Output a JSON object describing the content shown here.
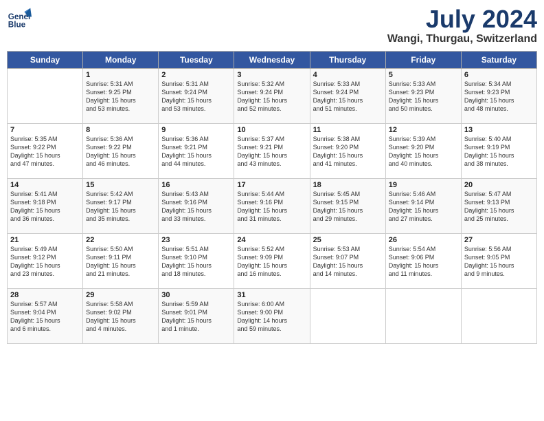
{
  "logo": {
    "line1": "General",
    "line2": "Blue"
  },
  "title": {
    "month_year": "July 2024",
    "location": "Wangi, Thurgau, Switzerland"
  },
  "days_of_week": [
    "Sunday",
    "Monday",
    "Tuesday",
    "Wednesday",
    "Thursday",
    "Friday",
    "Saturday"
  ],
  "weeks": [
    [
      {
        "day": "",
        "info": ""
      },
      {
        "day": "1",
        "info": "Sunrise: 5:31 AM\nSunset: 9:25 PM\nDaylight: 15 hours\nand 53 minutes."
      },
      {
        "day": "2",
        "info": "Sunrise: 5:31 AM\nSunset: 9:24 PM\nDaylight: 15 hours\nand 53 minutes."
      },
      {
        "day": "3",
        "info": "Sunrise: 5:32 AM\nSunset: 9:24 PM\nDaylight: 15 hours\nand 52 minutes."
      },
      {
        "day": "4",
        "info": "Sunrise: 5:33 AM\nSunset: 9:24 PM\nDaylight: 15 hours\nand 51 minutes."
      },
      {
        "day": "5",
        "info": "Sunrise: 5:33 AM\nSunset: 9:23 PM\nDaylight: 15 hours\nand 50 minutes."
      },
      {
        "day": "6",
        "info": "Sunrise: 5:34 AM\nSunset: 9:23 PM\nDaylight: 15 hours\nand 48 minutes."
      }
    ],
    [
      {
        "day": "7",
        "info": "Sunrise: 5:35 AM\nSunset: 9:22 PM\nDaylight: 15 hours\nand 47 minutes."
      },
      {
        "day": "8",
        "info": "Sunrise: 5:36 AM\nSunset: 9:22 PM\nDaylight: 15 hours\nand 46 minutes."
      },
      {
        "day": "9",
        "info": "Sunrise: 5:36 AM\nSunset: 9:21 PM\nDaylight: 15 hours\nand 44 minutes."
      },
      {
        "day": "10",
        "info": "Sunrise: 5:37 AM\nSunset: 9:21 PM\nDaylight: 15 hours\nand 43 minutes."
      },
      {
        "day": "11",
        "info": "Sunrise: 5:38 AM\nSunset: 9:20 PM\nDaylight: 15 hours\nand 41 minutes."
      },
      {
        "day": "12",
        "info": "Sunrise: 5:39 AM\nSunset: 9:20 PM\nDaylight: 15 hours\nand 40 minutes."
      },
      {
        "day": "13",
        "info": "Sunrise: 5:40 AM\nSunset: 9:19 PM\nDaylight: 15 hours\nand 38 minutes."
      }
    ],
    [
      {
        "day": "14",
        "info": "Sunrise: 5:41 AM\nSunset: 9:18 PM\nDaylight: 15 hours\nand 36 minutes."
      },
      {
        "day": "15",
        "info": "Sunrise: 5:42 AM\nSunset: 9:17 PM\nDaylight: 15 hours\nand 35 minutes."
      },
      {
        "day": "16",
        "info": "Sunrise: 5:43 AM\nSunset: 9:16 PM\nDaylight: 15 hours\nand 33 minutes."
      },
      {
        "day": "17",
        "info": "Sunrise: 5:44 AM\nSunset: 9:16 PM\nDaylight: 15 hours\nand 31 minutes."
      },
      {
        "day": "18",
        "info": "Sunrise: 5:45 AM\nSunset: 9:15 PM\nDaylight: 15 hours\nand 29 minutes."
      },
      {
        "day": "19",
        "info": "Sunrise: 5:46 AM\nSunset: 9:14 PM\nDaylight: 15 hours\nand 27 minutes."
      },
      {
        "day": "20",
        "info": "Sunrise: 5:47 AM\nSunset: 9:13 PM\nDaylight: 15 hours\nand 25 minutes."
      }
    ],
    [
      {
        "day": "21",
        "info": "Sunrise: 5:49 AM\nSunset: 9:12 PM\nDaylight: 15 hours\nand 23 minutes."
      },
      {
        "day": "22",
        "info": "Sunrise: 5:50 AM\nSunset: 9:11 PM\nDaylight: 15 hours\nand 21 minutes."
      },
      {
        "day": "23",
        "info": "Sunrise: 5:51 AM\nSunset: 9:10 PM\nDaylight: 15 hours\nand 18 minutes."
      },
      {
        "day": "24",
        "info": "Sunrise: 5:52 AM\nSunset: 9:09 PM\nDaylight: 15 hours\nand 16 minutes."
      },
      {
        "day": "25",
        "info": "Sunrise: 5:53 AM\nSunset: 9:07 PM\nDaylight: 15 hours\nand 14 minutes."
      },
      {
        "day": "26",
        "info": "Sunrise: 5:54 AM\nSunset: 9:06 PM\nDaylight: 15 hours\nand 11 minutes."
      },
      {
        "day": "27",
        "info": "Sunrise: 5:56 AM\nSunset: 9:05 PM\nDaylight: 15 hours\nand 9 minutes."
      }
    ],
    [
      {
        "day": "28",
        "info": "Sunrise: 5:57 AM\nSunset: 9:04 PM\nDaylight: 15 hours\nand 6 minutes."
      },
      {
        "day": "29",
        "info": "Sunrise: 5:58 AM\nSunset: 9:02 PM\nDaylight: 15 hours\nand 4 minutes."
      },
      {
        "day": "30",
        "info": "Sunrise: 5:59 AM\nSunset: 9:01 PM\nDaylight: 15 hours\nand 1 minute."
      },
      {
        "day": "31",
        "info": "Sunrise: 6:00 AM\nSunset: 9:00 PM\nDaylight: 14 hours\nand 59 minutes."
      },
      {
        "day": "",
        "info": ""
      },
      {
        "day": "",
        "info": ""
      },
      {
        "day": "",
        "info": ""
      }
    ]
  ]
}
